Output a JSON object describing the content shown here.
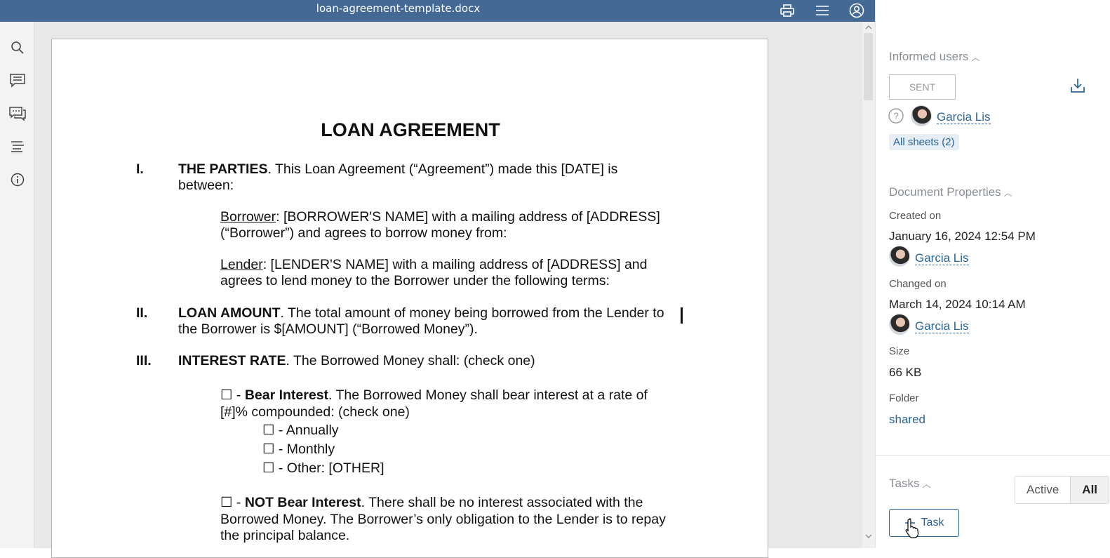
{
  "window": {
    "title": "loan-agreement-template.docx"
  },
  "toolbar": {
    "icons": [
      "print-icon",
      "menu-icon",
      "user-account-icon"
    ]
  },
  "leftbar": {
    "icons": [
      "search-icon",
      "comment-icon",
      "chat-icon",
      "outline-icon",
      "info-icon"
    ]
  },
  "document": {
    "title": "LOAN AGREEMENT",
    "s1_num": "I.",
    "s1_head": "THE PARTIES",
    "s1_l1": ". This Loan Agreement (“Agreement”) made this [DATE] is",
    "s1_l2": "between:",
    "borrower_label": "Borrower",
    "borrower_l1": ": [BORROWER'S NAME] with a mailing address of [ADDRESS]",
    "borrower_l2": "(“Borrower”) and agrees to borrow money from:",
    "lender_label": "Lender",
    "lender_l1": ": [LENDER'S NAME] with a mailing address of [ADDRESS] and",
    "lender_l2": "agrees to lend money to the Borrower under the following terms:",
    "s2_num": "II.",
    "s2_head": "LOAN AMOUNT",
    "s2_l1": ". The total amount of money being borrowed from the Lender to",
    "s2_l2": "the Borrower is $[AMOUNT] (“Borrowed Money”).",
    "s3_num": "III.",
    "s3_head": "INTEREST RATE",
    "s3_l1": ". The Borrowed Money shall: (check one)",
    "bear_prefix": "☐ - ",
    "bear_head": "Bear Interest",
    "bear_l1": ". The Borrowed Money shall bear interest at a rate of",
    "bear_l2": "[#]% compounded: (check one)",
    "opt1": "☐ - Annually",
    "opt2": "☐ - Monthly",
    "opt3": "☐ - Other: [OTHER]",
    "notbear_prefix": "☐ - ",
    "notbear_head": "NOT Bear Interest",
    "notbear_l1": ". There shall be no interest associated with the",
    "notbear_l2": "Borrowed Money. The Borrower’s only obligation to the Lender is to repay",
    "notbear_l3": "the principal balance."
  },
  "panel": {
    "informed": {
      "title": "Informed users",
      "status": "SENT",
      "user": "Garcia Lis",
      "sheets": "All sheets (2)"
    },
    "properties": {
      "title": "Document Properties",
      "created_label": "Created on",
      "created_value": "January 16, 2024 12:54 PM",
      "created_by": "Garcia Lis",
      "changed_label": "Changed on",
      "changed_value": "March 14, 2024 10:14 AM",
      "changed_by": "Garcia Lis",
      "size_label": "Size",
      "size_value": "66 KB",
      "folder_label": "Folder",
      "folder_value": "shared"
    },
    "tasks": {
      "title": "Tasks",
      "filter_active": "Active",
      "filter_all": "All",
      "add_label": "Task"
    }
  },
  "colors": {
    "titlebar": "#446995",
    "link": "#2a6496"
  }
}
